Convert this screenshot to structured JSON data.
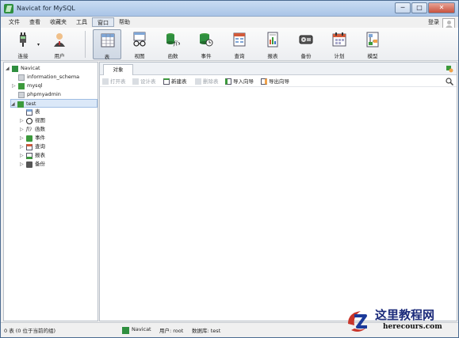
{
  "window": {
    "title": "Navicat for MySQL",
    "controls": [
      "─",
      "□",
      "✕"
    ]
  },
  "menu": {
    "items": [
      "文件",
      "查看",
      "收藏夹",
      "工具",
      "窗口",
      "帮助"
    ],
    "active_index": 4,
    "login_label": "登录"
  },
  "toolbar": {
    "connect": "连接",
    "user": "用户",
    "table": "表",
    "view": "视图",
    "function": "函数",
    "event": "事件",
    "query": "查询",
    "report": "报表",
    "backup": "备份",
    "schedule": "计划",
    "model": "模型"
  },
  "tree": {
    "root": "Navicat",
    "databases": [
      "information_schema",
      "mysql",
      "phpmyadmin",
      "test"
    ],
    "selected_db": "test",
    "test_children": [
      "表",
      "视图",
      "函数",
      "事件",
      "查询",
      "报表",
      "备份"
    ]
  },
  "tabs": {
    "objects": "对象"
  },
  "object_toolbar": {
    "open_table": "打开表",
    "design_table": "设计表",
    "new_table": "新建表",
    "delete_table": "删除表",
    "import_wizard": "导入向导",
    "export_wizard": "导出向导"
  },
  "status": {
    "left": "0 表 (0 位于当前的组)",
    "connection": "Navicat",
    "user": "用户: root",
    "database": "数据库: test"
  },
  "watermark": {
    "cn": "这里教程网",
    "en": "herecours.com"
  },
  "colors": {
    "accent": "#2f8f3f",
    "selection": "#dbe8f8",
    "titlebar": "#b9cfec"
  }
}
